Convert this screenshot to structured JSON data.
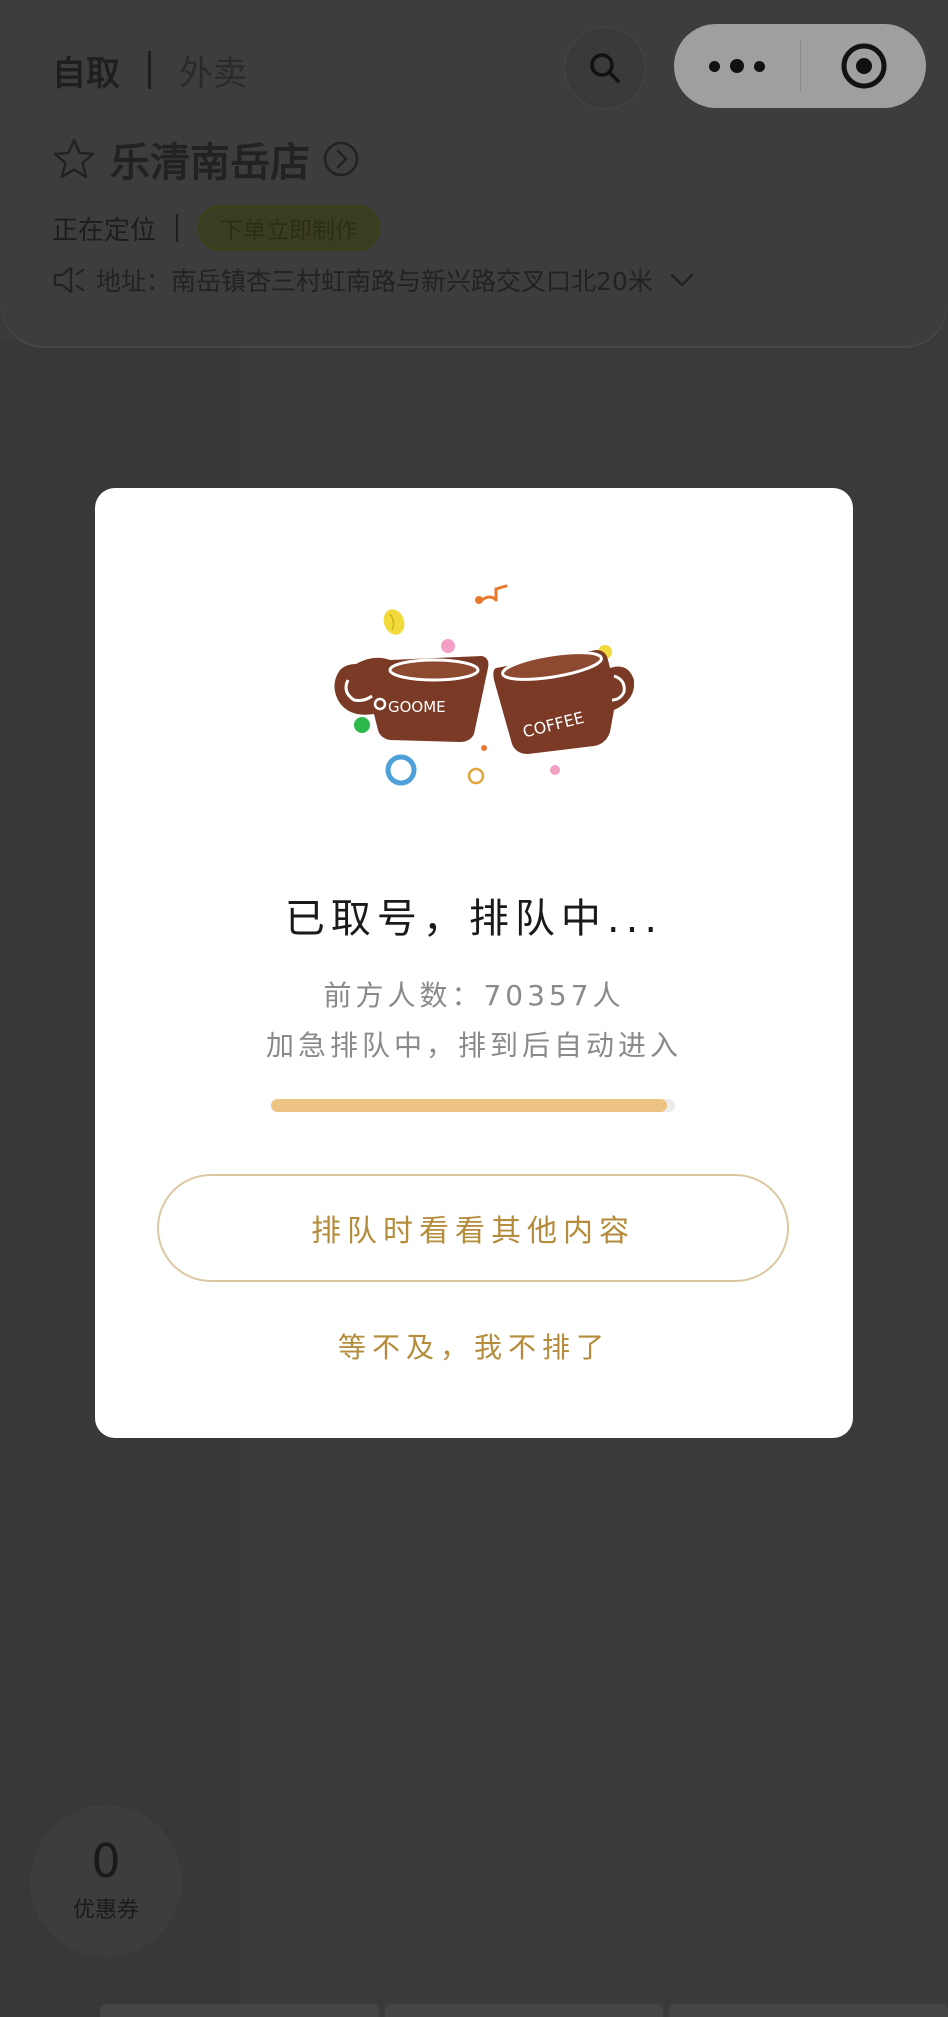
{
  "header": {
    "tab_pickup": "自取",
    "tab_delivery": "外卖"
  },
  "store": {
    "name": "乐清南岳店",
    "locating": "正在定位",
    "badge": "下单立即制作",
    "address": "地址：南岳镇杏三村虹南路与新兴路交叉口北20米"
  },
  "coupon": {
    "count": "0",
    "label": "优惠券"
  },
  "modal": {
    "illustration_text_left": "GOOME",
    "illustration_text_right": "COFFEE",
    "title": "已取号，排队中...",
    "ahead": "前方人数：70357人",
    "subtitle": "加急排队中，排到后自动进入",
    "progress": 0.98,
    "browse_button": "排队时看看其他内容",
    "quit_link": "等不及，我不排了"
  },
  "colors": {
    "accent_gold": "#b58c3c",
    "progress_fill": "#ecc383",
    "cup_brown": "#7a3a25"
  }
}
